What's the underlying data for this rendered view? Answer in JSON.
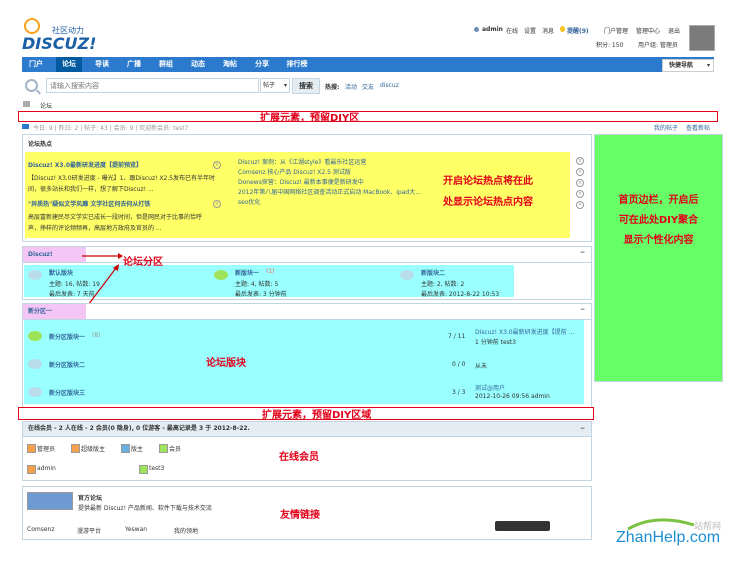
{
  "logo": {
    "tag": "社区动力",
    "name": "DISCUZ!"
  },
  "userbar": {
    "username": "admin",
    "status": "在线",
    "links": [
      "设置",
      "消息"
    ],
    "reminder": "提醒(9)",
    "links2": [
      "门户管理",
      "管理中心",
      "退出"
    ],
    "points": "积分: 150",
    "group": "用户组: 管理员"
  },
  "nav": {
    "items": [
      "门户",
      "论坛",
      "导读",
      "广播",
      "群组",
      "动态",
      "淘帖",
      "分享",
      "排行榜"
    ],
    "quick_nav": "快捷导航"
  },
  "search": {
    "placeholder": "请输入搜索内容",
    "type": "帖子",
    "button": "搜索",
    "hot_label": "热搜:",
    "hot_terms": [
      "活动",
      "交友",
      "discuz"
    ]
  },
  "breadcrumb": {
    "item": "论坛"
  },
  "annotations": {
    "diy_top": "扩展元素，预留DIY区",
    "diy_bottom": "扩展元素，预留DIY区域",
    "hot_line1": "开启论坛热点将在此",
    "hot_line2": "处显示论坛热点内容",
    "sidebar_line1": "首页边栏，开启后",
    "sidebar_line2": "可在此处DIY聚合",
    "sidebar_line3": "显示个性化内容",
    "forum_cat": "论坛分区",
    "forum_block": "论坛版块",
    "online": "在线会员",
    "links": "友情链接"
  },
  "stats": {
    "text": "今日: 9 | 昨日: 2 | 帖子: 43 | 会员: 9 | 欢迎新会员: test7",
    "my_posts": "我的帖子",
    "new_replies": "查看新帖"
  },
  "hot": {
    "title": "论坛热点",
    "item1_title": "Discuz! X3.0最新研发进度【提前预览】",
    "item1_body_1": "【Discuz! X3.0研发进度 - 曝光】1、跟Discuz! X2.5发布已有半年时",
    "item1_body_2": "间，很多站长和我们一样，想了解下Discuz! ...",
    "item2_title": "\"异质热\"疑似文学风靡 文学社区何去何从打铁",
    "item2_body_1": "高层富新建民尽文学实已成长一段时间，但是网民对于比事的恰呼",
    "item2_body_2": "声，挣样的评论频频再，高层地方政府及官员的 ...",
    "list": [
      "Discuz! 案例：从《江湖style》看最乐社区运营",
      "Comsenz 核心产品 Discuz! X2.5 测试版",
      "Donews探营：Discuz! 最新本事便是新研发中",
      "2012年第八届中国网络社区调查活动正式启动 MacBook、ipad大...",
      "seo优化"
    ]
  },
  "cat1": {
    "title": "Discuz!",
    "forums": [
      {
        "name": "默认版块",
        "stats": "主题: 16, 帖数: 19",
        "last": "最后发表: 7 天前"
      },
      {
        "name": "新版块一",
        "today": "(1)",
        "stats": "主题: 4, 帖数: 5",
        "last": "最后发表: 3 分钟前"
      },
      {
        "name": "新版块二",
        "stats": "主题: 2, 帖数: 2",
        "last": "最后发表: 2012-8-22 10:53"
      }
    ]
  },
  "cat2": {
    "title": "新分区一",
    "forums": [
      {
        "name": "新分区版块一",
        "today": "(8)",
        "count": "7 / 11",
        "last_title": "Discuz! X3.0最新研发进度【提前 ...",
        "last_meta": "1 分钟前 test3"
      },
      {
        "name": "新分区版块二",
        "count": "0 / 0",
        "last_title": "从未",
        "last_meta": ""
      },
      {
        "name": "新分区版块三",
        "count": "3 / 3",
        "last_title": "测试@用户",
        "last_meta": "2012-10-26 09:56 admin"
      }
    ]
  },
  "online": {
    "title": "在线会员 - 2 人在线 - 2 会员(0 隐身), 0 位游客 - 最高记录是 3 于 2012-8-22.",
    "roles": [
      "管理员",
      "超级版主",
      "版主",
      "会员"
    ],
    "users": [
      "admin",
      "test3"
    ]
  },
  "links": {
    "site_name": "官方论坛",
    "site_desc": "提供最新 Discuz! 产品新闻、软件下载与技术交流",
    "items": [
      "Comsenz",
      "漫游平台",
      "Yeswan",
      "我的领地"
    ]
  },
  "watermark": {
    "text": "ZhanHelp.com",
    "sub": "站帮网"
  },
  "colors": {
    "nav": "#2b7acd",
    "hot_bg": "#ffff66",
    "sidebar_bg": "#66ff66",
    "forum_bg": "#99ffff",
    "cat_head": "#f3c6f6",
    "annotation": "#e2001a"
  }
}
